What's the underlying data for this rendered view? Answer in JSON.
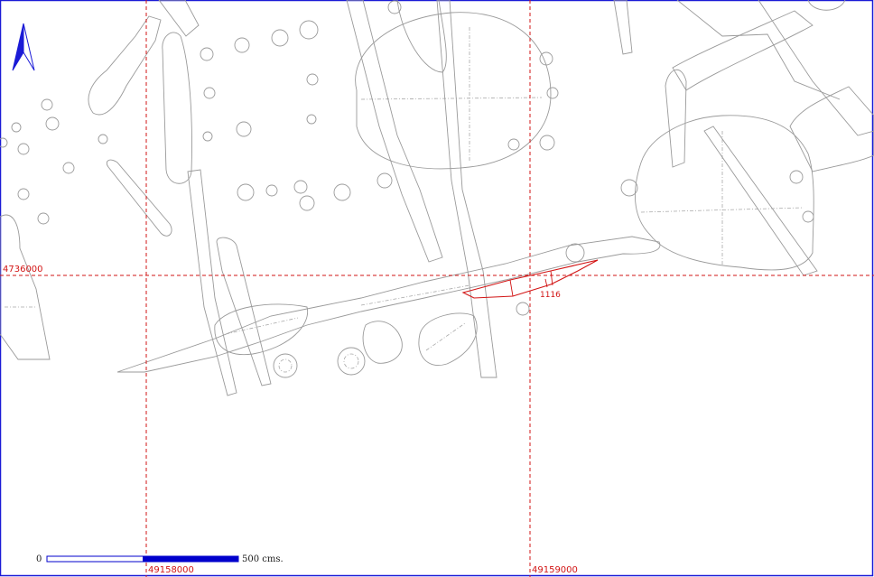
{
  "map": {
    "grid_labels": {
      "northing": "4736000",
      "easting_left": "49158000",
      "easting_right": "49159000"
    },
    "feature_label": "1116",
    "scale_bar": {
      "start": "0",
      "end": "500 cms."
    },
    "north_arrow_icon": "north-arrow-icon",
    "colors": {
      "frame": "#1a1ad6",
      "grid": "#d21414",
      "highlight": "#d21414",
      "features": "#9a9a9a",
      "scale_bar": "#0000cc"
    }
  }
}
